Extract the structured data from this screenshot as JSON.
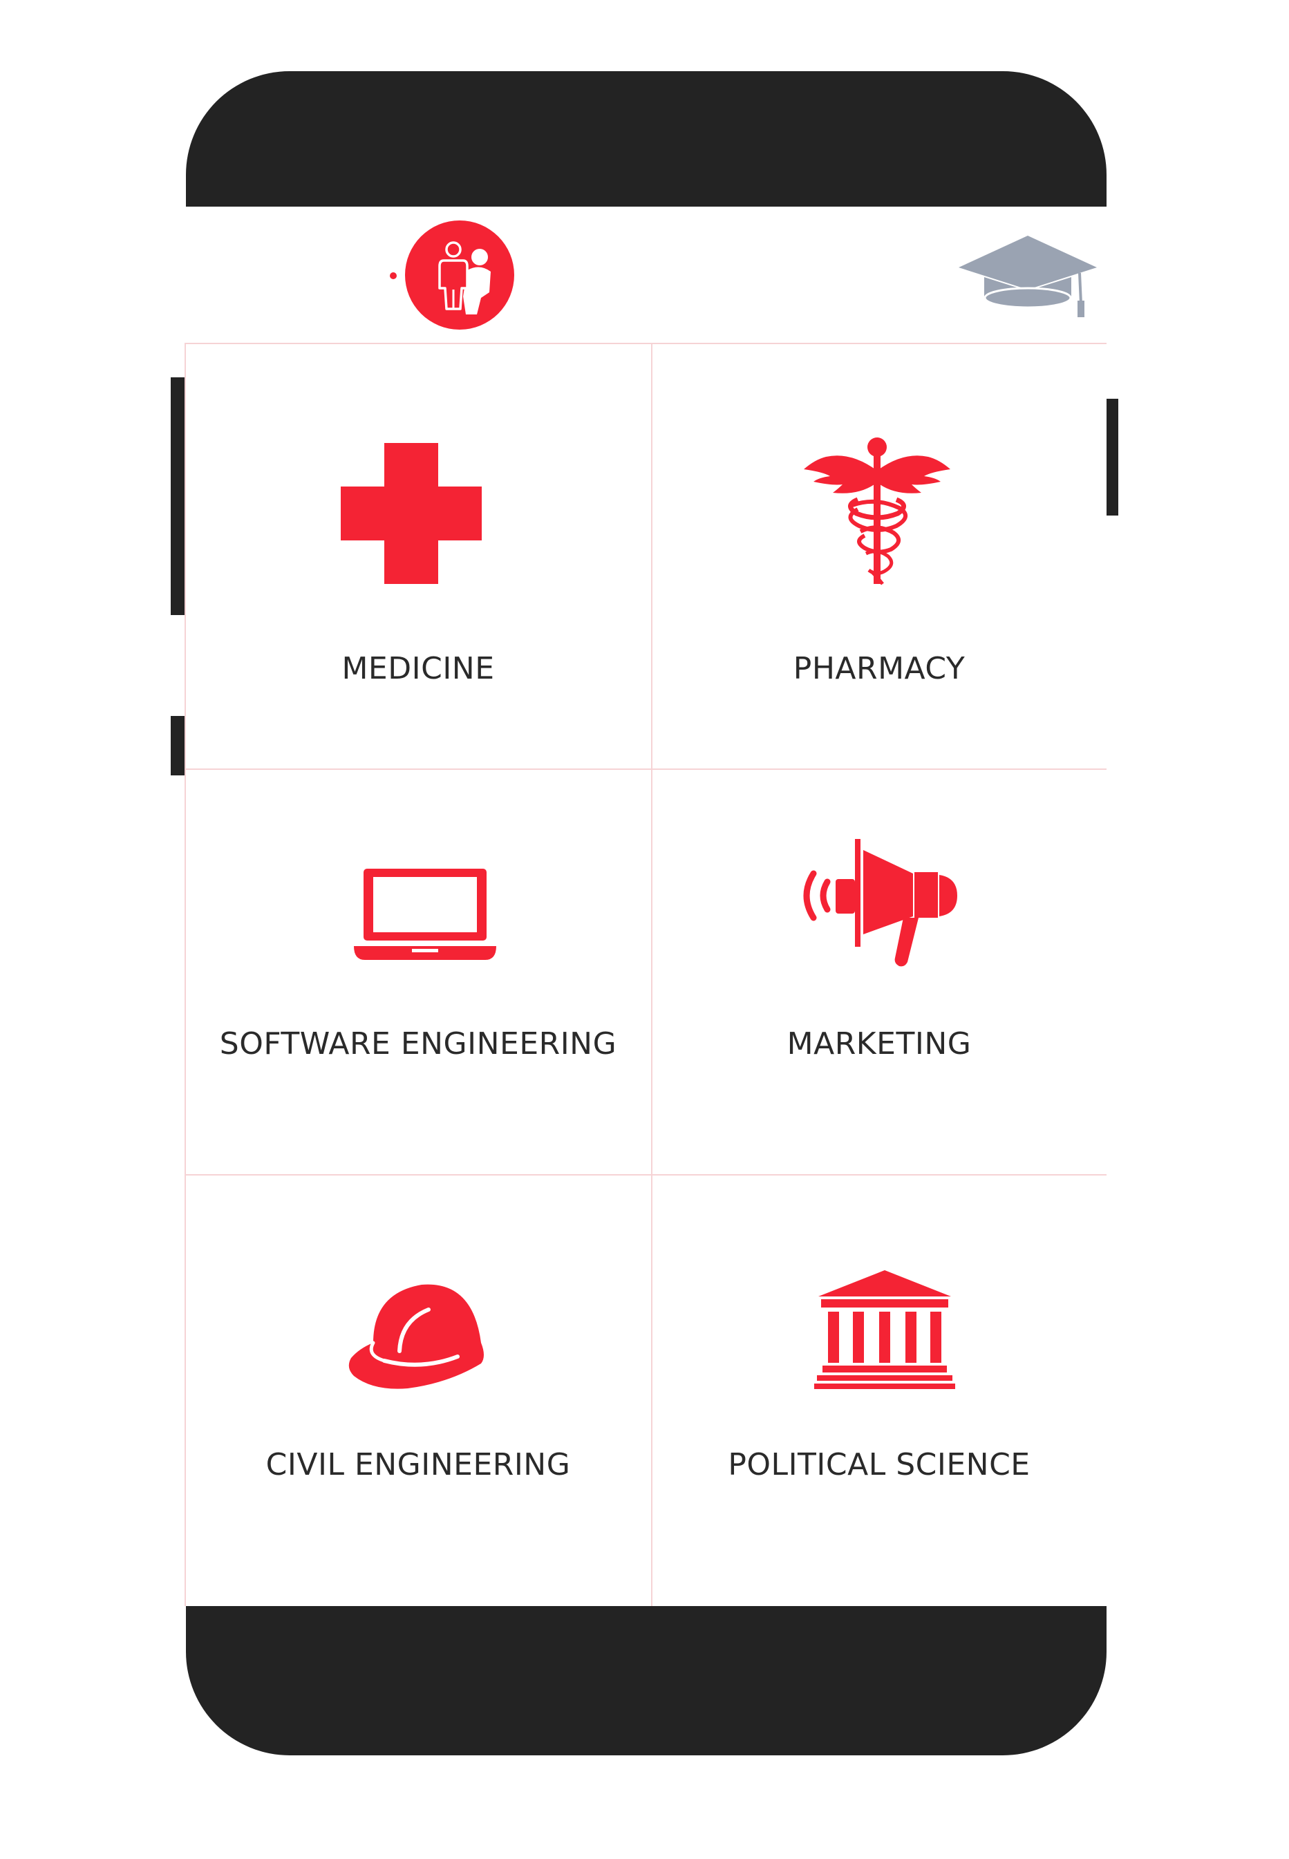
{
  "colors": {
    "accent": "#f42334",
    "phone_body": "#232323",
    "label_text": "#2a2a2a",
    "divider": "#f6d3d5",
    "cap_gray": "#9aa3b2"
  },
  "tabs": [
    {
      "icon": "people-icon",
      "active": true
    },
    {
      "icon": "graduation-cap-icon",
      "active": false
    }
  ],
  "courses": [
    {
      "label": "MEDICINE",
      "icon": "medical-cross-icon"
    },
    {
      "label": "PHARMACY",
      "icon": "caduceus-icon"
    },
    {
      "label": "SOFTWARE ENGINEERING",
      "icon": "laptop-icon"
    },
    {
      "label": "MARKETING",
      "icon": "megaphone-icon"
    },
    {
      "label": "CIVIL ENGINEERING",
      "icon": "hard-hat-icon"
    },
    {
      "label": "POLITICAL SCIENCE",
      "icon": "government-building-icon"
    }
  ]
}
